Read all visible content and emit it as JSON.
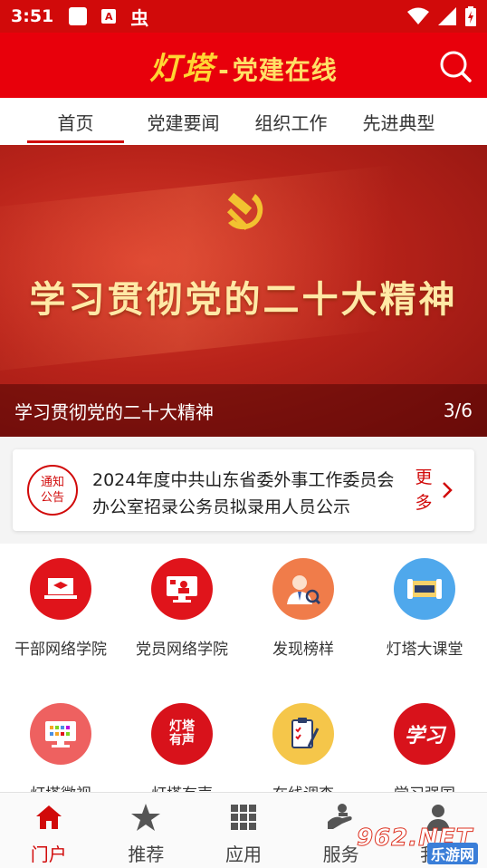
{
  "status_bar": {
    "time": "3:51",
    "icons": [
      "app-square-icon",
      "a-box-icon",
      "bug-icon",
      "wifi-icon",
      "signal-icon",
      "battery-icon"
    ]
  },
  "header": {
    "logo_main": "灯塔",
    "logo_dash": "-",
    "logo_sub": "党建在线",
    "search_icon": "search-icon"
  },
  "tabs": [
    {
      "label": "首页",
      "active": true
    },
    {
      "label": "党建要闻",
      "active": false
    },
    {
      "label": "组织工作",
      "active": false
    },
    {
      "label": "先进典型",
      "active": false
    }
  ],
  "banner": {
    "headline": "学习贯彻党的二十大精神",
    "caption": "学习贯彻党的二十大精神",
    "counter": "3/6"
  },
  "notice": {
    "badge_line1": "通知",
    "badge_line2": "公告",
    "text": "2024年度中共山东省委外事工作委员会办公室招录公务员拟录用人员公示",
    "more_line1": "更",
    "more_line2": "多"
  },
  "grid": [
    {
      "label": "干部网络学院",
      "icon": "laptop-graduation-icon",
      "color": "#e0141b"
    },
    {
      "label": "党员网络学院",
      "icon": "party-monitor-icon",
      "color": "#e0141b"
    },
    {
      "label": "发现榜样",
      "icon": "person-search-icon",
      "color": "#f07c4a"
    },
    {
      "label": "灯塔大课堂",
      "icon": "scroll-icon",
      "color": "#4fa8ec"
    },
    {
      "label": "灯塔微视",
      "icon": "tv-icon",
      "color": "#ee6160"
    },
    {
      "label": "灯塔有声",
      "icon": "calligraphy-seal-icon",
      "color": "#d8121b",
      "seal_text": "灯塔有声"
    },
    {
      "label": "在线调查",
      "icon": "clipboard-pen-icon",
      "color": "#f5c64a"
    },
    {
      "label": "学习强国",
      "icon": "xuexi-logo-icon",
      "color": "#d8121b",
      "seal_text": "学习"
    }
  ],
  "bottom_nav": [
    {
      "label": "门户",
      "icon": "home-icon",
      "active": true
    },
    {
      "label": "推荐",
      "icon": "star-icon",
      "active": false
    },
    {
      "label": "应用",
      "icon": "grid-icon",
      "active": false
    },
    {
      "label": "服务",
      "icon": "hand-service-icon",
      "active": false
    },
    {
      "label": "我的",
      "icon": "user-icon",
      "active": false
    }
  ],
  "watermark": {
    "number": "962.NET",
    "site": "乐游网"
  },
  "colors": {
    "brand_red": "#e8000b",
    "status_red": "#d10a0a",
    "gold": "#ffd633"
  }
}
